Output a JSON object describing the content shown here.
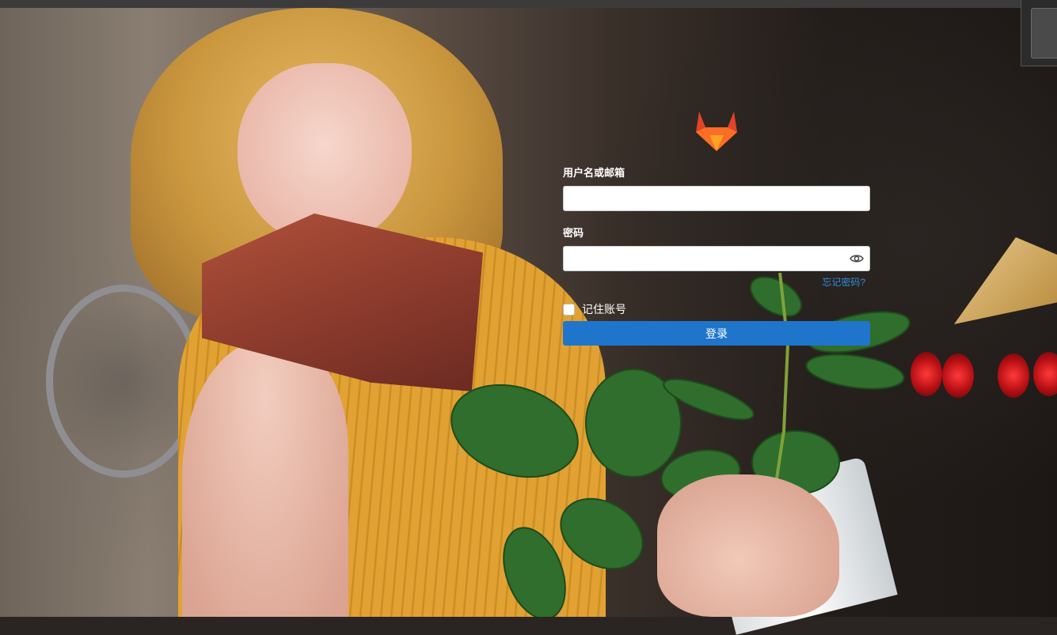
{
  "login": {
    "username_label": "用户名或邮箱",
    "username_value": "",
    "password_label": "密码",
    "password_value": "",
    "forgot_password": "忘记密码?",
    "remember_label": "记住账号",
    "remember_checked": false,
    "submit_label": "登录"
  },
  "icons": {
    "logo": "gitlab-logo",
    "password_toggle": "eye-icon"
  },
  "colors": {
    "accent": "#1f75cb",
    "link": "#2f8fdc",
    "logo_orange": "#e24329",
    "logo_light": "#fca326"
  }
}
